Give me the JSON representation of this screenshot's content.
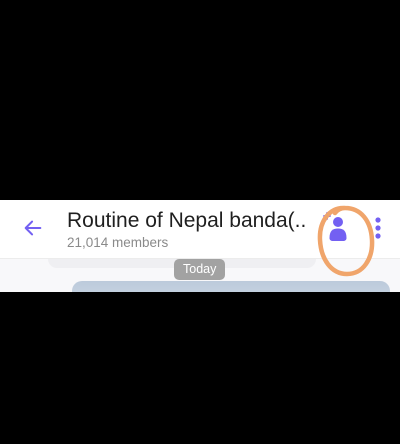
{
  "header": {
    "title": "Routine of Nepal banda(...",
    "subtitle": "21,014 members",
    "back_icon": "arrow-left-icon",
    "add_member_icon": "add-person-icon",
    "more_icon": "more-vertical-icon"
  },
  "chat": {
    "date_label": "Today"
  },
  "colors": {
    "accent": "#7360f2",
    "annotation": "#f0a56b",
    "title_text": "#1f1f1f",
    "subtitle_text": "#8a8a8a",
    "date_pill": "#a2a2a2"
  }
}
